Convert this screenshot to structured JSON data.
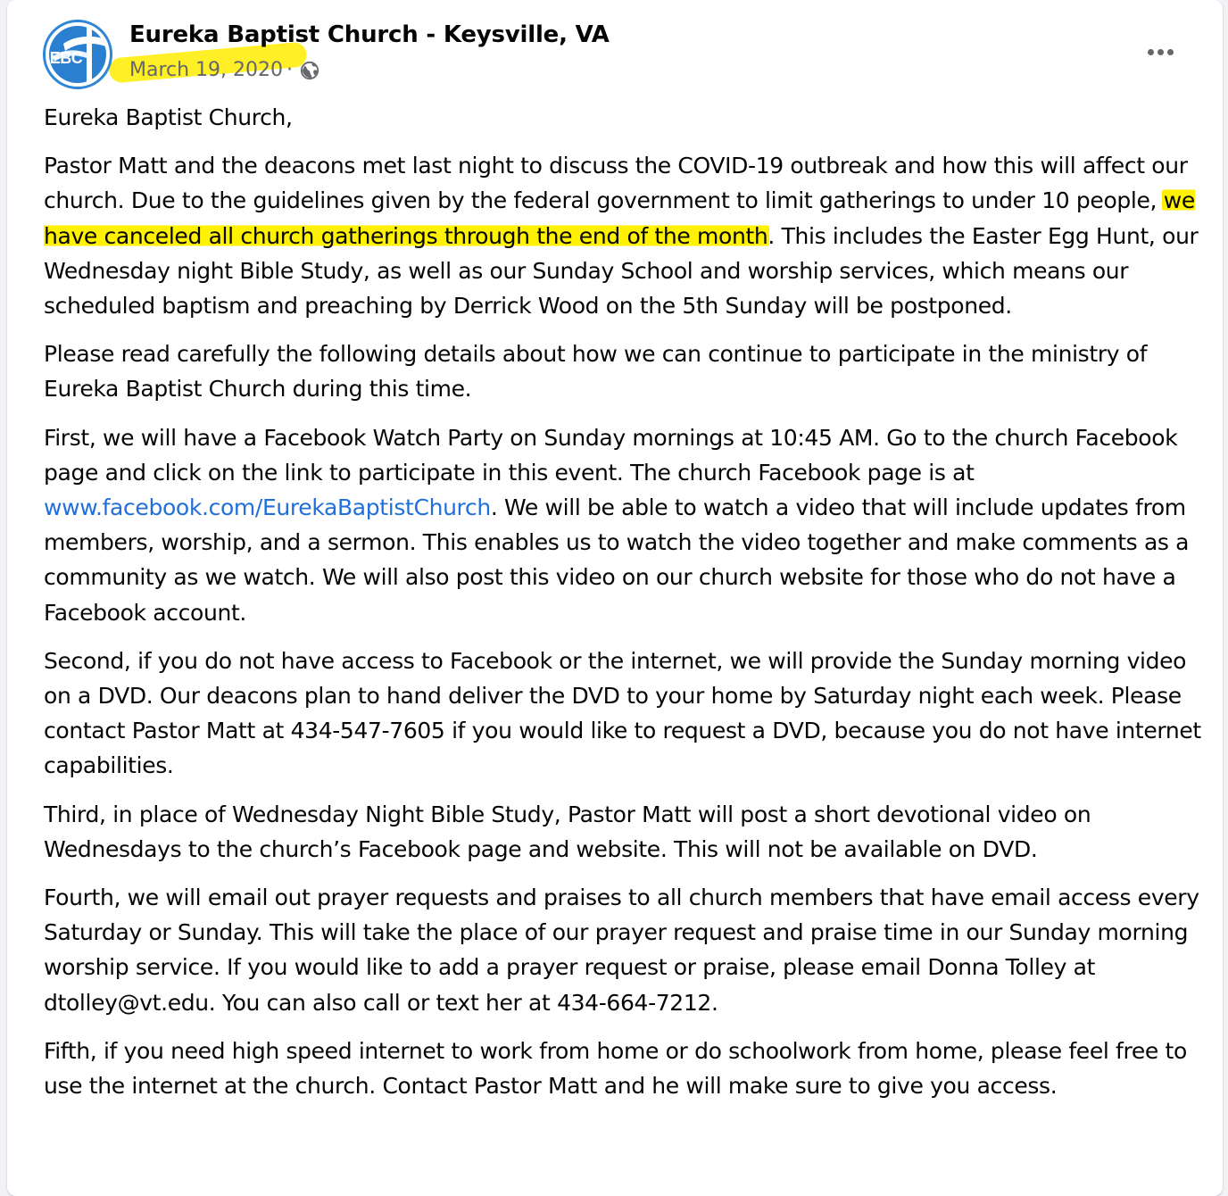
{
  "post": {
    "author": "Eureka Baptist Church - Keysville, VA",
    "avatar_text": "EBC",
    "date": "March 19, 2020",
    "separator": " · ",
    "privacy_icon": "globe-icon",
    "more_icon": "more-options-icon"
  },
  "highlight_color": "#fff200",
  "link_color": "#216fdb",
  "paragraphs": {
    "p1": "Eureka Baptist Church,",
    "p2a": "Pastor Matt and the deacons met last night to discuss the COVID-19 outbreak and how this will affect our church. Due to the guidelines given by the federal government to limit gatherings to under 10 people, ",
    "p2_highlight": "we have canceled all church gatherings through the end of the month",
    "p2b": ".  This includes the Easter Egg Hunt, our Wednesday night Bible Study, as well as our Sunday School and worship services, which means our scheduled baptism and preaching by Derrick Wood on the 5th Sunday will be postponed.",
    "p3": "Please read carefully the following details about how we can continue to participate in the ministry of Eureka Baptist Church during this time.",
    "p4a": "First, we will have a Facebook Watch Party on Sunday mornings at 10:45 AM.  Go to the church Facebook page and click on the link to participate in this event.  The church Facebook page is at ",
    "p4_link": "www.facebook.com/EurekaBaptistChurch",
    "p4b": ".  We will be able to watch a video that will include updates from members, worship, and a sermon.  This enables us to watch the video together and make comments as a community as we watch.  We will also post this video on our church website for those who do not have a Facebook account.",
    "p5": "Second, if you do not have access to Facebook or the internet, we will provide the Sunday morning video on a DVD.  Our deacons plan to hand deliver the DVD to your home by Saturday night each week.  Please contact Pastor Matt at 434-547-7605 if you would like to request a DVD, because you do not have internet capabilities.",
    "p6": "Third, in place of Wednesday Night Bible Study, Pastor Matt will post a short devotional video on Wednesdays to the church’s Facebook page and website.  This will not be available on DVD.",
    "p7": "Fourth, we will email out prayer requests and praises to all church members that have email access every Saturday or Sunday.  This will take the place of our prayer request and praise time in our Sunday morning worship service.  If you would like to add a prayer request or praise, please email Donna Tolley at dtolley@vt.edu.  You can also call or text her at 434-664-7212.",
    "p8": "Fifth, if you need high speed internet to work from home or do schoolwork from home, please feel free to use the internet at the church.  Contact Pastor Matt and he will make sure to give you access."
  }
}
